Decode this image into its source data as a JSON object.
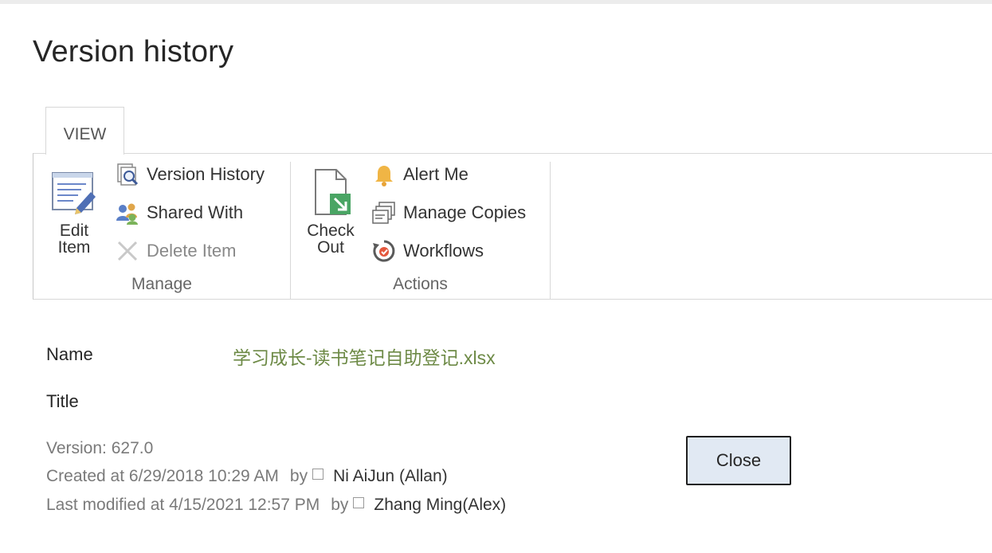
{
  "page": {
    "title": "Version history"
  },
  "ribbon": {
    "tab_label": "VIEW",
    "groups": [
      {
        "label": "Manage",
        "big_button": {
          "label": "Edit\nItem",
          "icon": "edit-item-icon"
        },
        "items": [
          {
            "label": "Version History",
            "icon": "version-history-icon",
            "enabled": true
          },
          {
            "label": "Shared With",
            "icon": "shared-with-icon",
            "enabled": true
          },
          {
            "label": "Delete Item",
            "icon": "delete-icon",
            "enabled": false
          }
        ]
      },
      {
        "label": "Actions",
        "big_button": {
          "label": "Check\nOut",
          "icon": "check-out-icon"
        },
        "items": [
          {
            "label": "Alert Me",
            "icon": "bell-icon",
            "enabled": true
          },
          {
            "label": "Manage Copies",
            "icon": "manage-copies-icon",
            "enabled": true
          },
          {
            "label": "Workflows",
            "icon": "workflows-icon",
            "enabled": true
          }
        ]
      }
    ]
  },
  "properties": {
    "name_label": "Name",
    "name_value": "学习成长-读书笔记自助登记.xlsx",
    "title_label": "Title"
  },
  "meta": {
    "version": "Version: 627.0",
    "created": "Created at 6/29/2018 10:29 AM",
    "created_by_word": "by",
    "created_by": "Ni AiJun (Allan)",
    "modified": "Last modified at 4/15/2021 12:57 PM",
    "modified_by_word": "by",
    "modified_by": "Zhang Ming(Alex)"
  },
  "close_label": "Close",
  "colors": {
    "link_green": "#6d8a46",
    "button_bg": "#e1e9f3"
  }
}
